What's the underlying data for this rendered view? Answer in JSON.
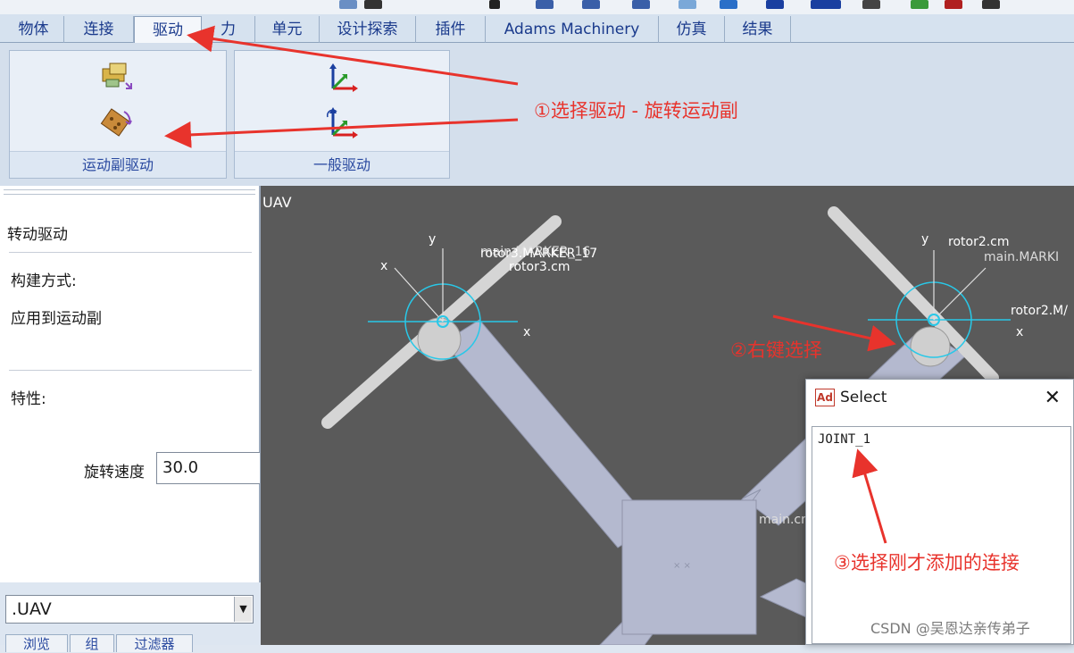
{
  "tabs": [
    {
      "label": "物体",
      "active": false
    },
    {
      "label": "连接",
      "active": false
    },
    {
      "label": "驱动",
      "active": true
    },
    {
      "label": "力",
      "active": false
    },
    {
      "label": "单元",
      "active": false
    },
    {
      "label": "设计探索",
      "active": false
    },
    {
      "label": "插件",
      "active": false
    },
    {
      "label": "Adams Machinery",
      "active": false
    },
    {
      "label": "仿真",
      "active": false
    },
    {
      "label": "结果",
      "active": false
    }
  ],
  "ribbon": {
    "group1_label": "运动副驱动",
    "group2_label": "一般驱动",
    "icons": [
      "translational-joint-motion-icon",
      "rotational-joint-motion-icon",
      "single-component-motion-icon",
      "general-point-motion-icon"
    ]
  },
  "panel": {
    "title": "转动驱动",
    "build_label": "构建方式:",
    "build_value": "应用到运动副",
    "props_label": "特性:",
    "speed_label": "旋转速度",
    "speed_value": "30.0",
    "model_combo": ".UAV",
    "bottom_tabs": [
      "浏览",
      "组",
      "过滤器"
    ]
  },
  "viewport": {
    "model_name": "UAV",
    "labels": {
      "rotor3_cm": "rotor3.cm",
      "marker_overlap": "rotor3.MARKER_17",
      "marker_16": "main.MARKER_16",
      "rotor2_cm": "rotor2.cm",
      "main_marker": "main.MARKI",
      "rotor2_ma": "rotor2.M/",
      "main_cm": "main.cm",
      "axis_x": "x",
      "axis_y": "y"
    }
  },
  "dialog": {
    "app_badge": "Ad",
    "title": "Select",
    "items": [
      "JOINT_1"
    ]
  },
  "annotations": {
    "step1": "①选择驱动 - 旋转运动副",
    "step2": "②右键选择",
    "step3": "③选择刚才添加的连接"
  },
  "watermark": "CSDN @吴恩达亲传弟子",
  "colors": {
    "annotation_red": "#e8332c",
    "tab_text": "#1a3a8c",
    "viewport_bg": "#5a5a5a",
    "part_color": "#b4b9cf"
  }
}
